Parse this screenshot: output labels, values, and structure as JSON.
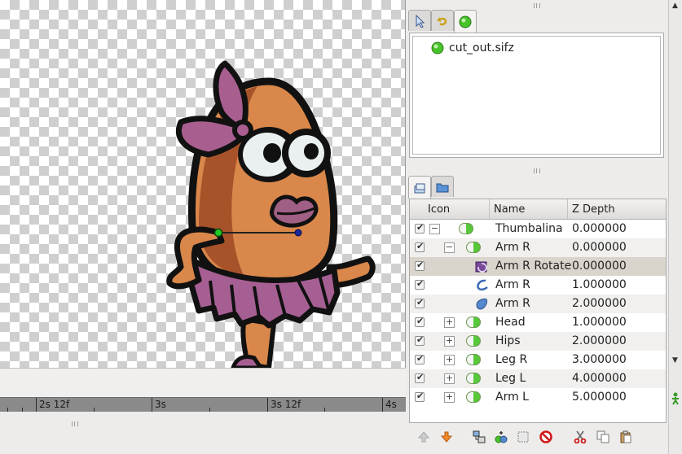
{
  "canvas": {
    "character": "Thumbalina",
    "colors": {
      "body": "#d9874a",
      "body_shadow": "#a8522a",
      "outline": "#111111",
      "bow": "#a85f90",
      "skirt": "#a65f92",
      "handle_green": "#22cc22",
      "handle_blue": "#1a2a9a"
    }
  },
  "timeline": {
    "ticks": [
      "2s 12f",
      "3s",
      "3s 12f",
      "4s"
    ]
  },
  "navigator": {
    "tabs": [
      "arrow-tool-icon",
      "history-icon",
      "canvas-browser-icon"
    ],
    "file": "cut_out.sifz"
  },
  "layers_panel": {
    "tabs": [
      "layers-icon",
      "library-icon"
    ],
    "columns": {
      "icon": "Icon",
      "name": "Name",
      "zdepth": "Z Depth"
    },
    "rows": [
      {
        "name": "Thumbalina",
        "zdepth": "0.000000",
        "expander": "−",
        "icon": "group-layer-icon",
        "checked": true
      },
      {
        "name": "Arm R",
        "zdepth": "0.000000",
        "expander": "−",
        "icon": "group-layer-icon",
        "checked": true
      },
      {
        "name": "Arm R Rotate",
        "zdepth": "0.000000",
        "expander": "",
        "icon": "rotate-layer-icon",
        "checked": true,
        "selected": true
      },
      {
        "name": "Arm R",
        "zdepth": "1.000000",
        "expander": "",
        "icon": "outline-layer-icon",
        "checked": true
      },
      {
        "name": "Arm R",
        "zdepth": "2.000000",
        "expander": "",
        "icon": "region-layer-icon",
        "checked": true
      },
      {
        "name": "Head",
        "zdepth": "1.000000",
        "expander": "+",
        "icon": "group-layer-icon",
        "checked": true
      },
      {
        "name": "Hips",
        "zdepth": "2.000000",
        "expander": "+",
        "icon": "group-layer-icon",
        "checked": true
      },
      {
        "name": "Leg R",
        "zdepth": "3.000000",
        "expander": "+",
        "icon": "group-layer-icon",
        "checked": true
      },
      {
        "name": "Leg L",
        "zdepth": "4.000000",
        "expander": "+",
        "icon": "group-layer-icon",
        "checked": true
      },
      {
        "name": "Arm L",
        "zdepth": "5.000000",
        "expander": "+",
        "icon": "group-layer-icon",
        "checked": true
      }
    ],
    "toolbar": [
      "raise-layer-icon",
      "lower-layer-icon",
      "encapsulate-icon",
      "duplicate-layer-icon",
      "select-layer-icon",
      "delete-layer-icon",
      "cut-icon",
      "copy-icon",
      "paste-icon"
    ]
  }
}
